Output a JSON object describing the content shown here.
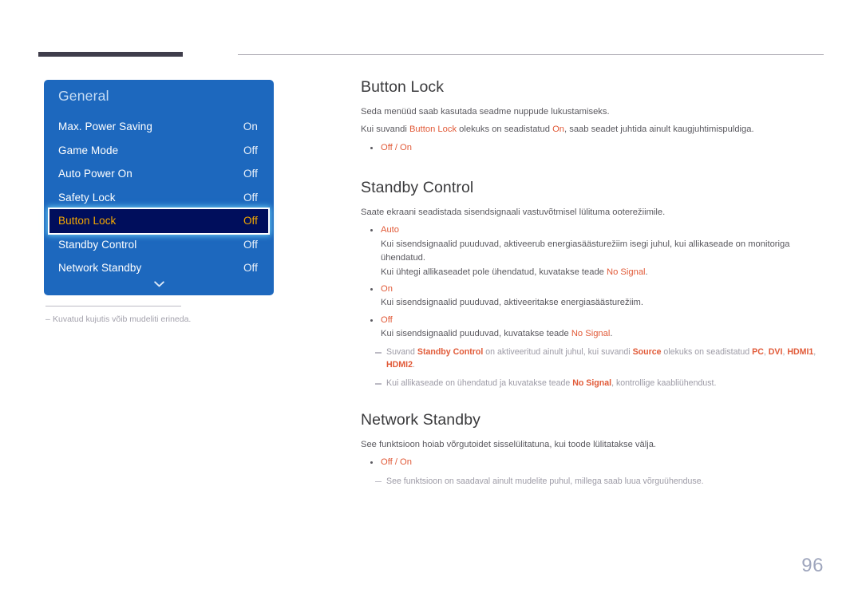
{
  "header": {
    "rule_thick_color": "#3f3d4b",
    "rule_thin_color": "#a9a7b0"
  },
  "osd": {
    "title": "General",
    "background_color": "#1d68be",
    "selected_bg_color": "#000e5c",
    "selected_text_color": "#f4a800",
    "items": [
      {
        "label": "Max. Power Saving",
        "value": "On",
        "selected": false
      },
      {
        "label": "Game Mode",
        "value": "Off",
        "selected": false
      },
      {
        "label": "Auto Power On",
        "value": "Off",
        "selected": false
      },
      {
        "label": "Safety Lock",
        "value": "Off",
        "selected": false
      },
      {
        "label": "Button Lock",
        "value": "Off",
        "selected": true
      },
      {
        "label": "Standby Control",
        "value": "Off",
        "selected": false
      },
      {
        "label": "Network Standby",
        "value": "Off",
        "selected": false
      }
    ],
    "scroll_icon": "chevron-down-icon",
    "footnote_dash": "–",
    "footnote": "Kuvatud kujutis võib mudeliti erineda."
  },
  "content": {
    "accent_color": "#e15a38",
    "sections": [
      {
        "title": "Button Lock",
        "p1": "Seda menüüd saab kasutada seadme nuppude lukustamiseks.",
        "p2_a": "Kui suvandi ",
        "p2_hl1": "Button Lock",
        "p2_b": " olekuks on seadistatud ",
        "p2_hl2": "On",
        "p2_c": ", saab seadet juhtida ainult kaugjuhtimispuldiga.",
        "opt_off": "Off",
        "opt_sep": " / ",
        "opt_on": "On"
      },
      {
        "title": "Standby Control",
        "p1": "Saate ekraani seadistada sisendsignaali vastuvõtmisel lülituma ooterežiimile.",
        "b1_opt": "Auto",
        "b1_sub1": "Kui sisendsignaalid puuduvad, aktiveerub energiasäästurežiim isegi juhul, kui allikaseade on monitoriga ühendatud.",
        "b1_sub2_a": "Kui ühtegi allikaseadet pole ühendatud, kuvatakse teade ",
        "b1_sub2_hl": "No Signal",
        "b1_sub2_b": ".",
        "b2_opt": "On",
        "b2_sub": "Kui sisendsignaalid puuduvad, aktiveeritakse energiasäästurežiim.",
        "b3_opt": "Off",
        "b3_sub_a": "Kui sisendsignaalid puuduvad, kuvatakse teade ",
        "b3_sub_hl": "No Signal",
        "b3_sub_b": ".",
        "note1_a": "Suvand ",
        "note1_hl1": "Standby Control",
        "note1_b": " on aktiveeritud ainult juhul, kui suvandi ",
        "note1_hl2": "Source",
        "note1_c": " olekuks on seadistatud ",
        "note1_hl3": "PC",
        "note1_d": ", ",
        "note1_hl4": "DVI",
        "note1_e": ", ",
        "note1_hl5": "HDMI1",
        "note1_f": ", ",
        "note1_hl6": "HDMI2",
        "note1_g": ".",
        "note2_a": "Kui allikaseade on ühendatud ja kuvatakse teade ",
        "note2_hl": "No Signal",
        "note2_b": ", kontrollige kaabliühendust."
      },
      {
        "title": "Network Standby",
        "p1": "See funktsioon hoiab võrgutoidet sisselülitatuna, kui toode lülitatakse välja.",
        "opt_off": "Off",
        "opt_sep": " / ",
        "opt_on": "On",
        "note1": "See funktsioon on saadaval ainult mudelite puhul, millega saab luua võrguühenduse."
      }
    ]
  },
  "page_number": "96"
}
